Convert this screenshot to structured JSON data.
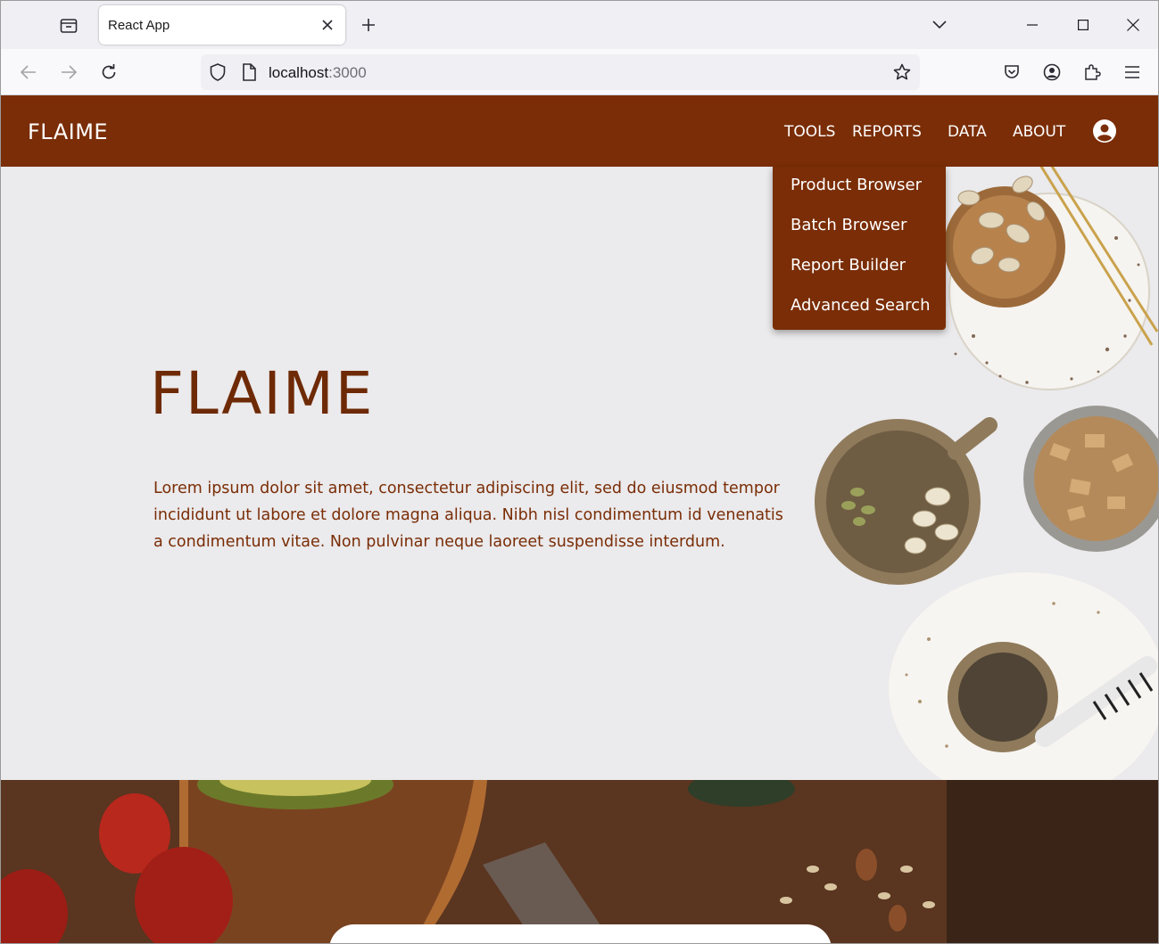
{
  "browser": {
    "tab_title": "React App",
    "url_host": "localhost",
    "url_port": ":3000"
  },
  "app": {
    "brand": "FLAIME",
    "menu": [
      {
        "label": "TOOLS"
      },
      {
        "label": "REPORTS"
      },
      {
        "label": "DATA"
      },
      {
        "label": "ABOUT"
      }
    ],
    "dropdown": [
      {
        "label": "Product Browser"
      },
      {
        "label": "Batch Browser"
      },
      {
        "label": "Report Builder"
      },
      {
        "label": "Advanced Search"
      }
    ]
  },
  "hero": {
    "title": "FLAIME",
    "text": "Lorem ipsum dolor sit amet, consectetur adipiscing elit, sed do eiusmod tempor incididunt ut labore et dolore magna aliqua. Nibh nisl condimentum id venenatis a condimentum vitae. Non pulvinar neque laoreet suspendisse interdum."
  },
  "colors": {
    "brand_brown": "#7a2d06",
    "hero_bg": "#ebeaec"
  }
}
